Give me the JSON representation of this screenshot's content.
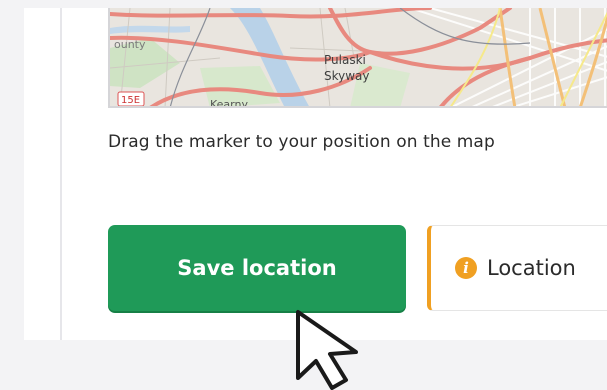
{
  "map": {
    "labels": {
      "place_partial": "ounty",
      "pulaski": "Pulaski",
      "skyway": "Skyway",
      "route_shield": "15E",
      "kearny_partial": "Kearny"
    }
  },
  "hint_text": "Drag the marker to your position on the map",
  "save_button_label": "Save location",
  "status": {
    "label": "Location",
    "icon": "info-icon",
    "accent_color": "#f0a022"
  },
  "colors": {
    "primary_green": "#1f9a58",
    "warning_orange": "#f0a022"
  },
  "cursor": "pointer-arrow-icon"
}
